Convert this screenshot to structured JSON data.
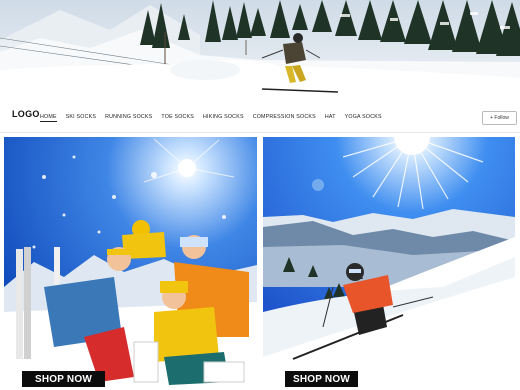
{
  "brand": {
    "logo_text": "LOGO"
  },
  "nav": {
    "items": [
      {
        "label": "HOME"
      },
      {
        "label": "SKI SOCKS"
      },
      {
        "label": "RUNNING SOCKS"
      },
      {
        "label": "TOE SOCKS"
      },
      {
        "label": "HIKING SOCKS"
      },
      {
        "label": "COMPRESSION SOCKS"
      },
      {
        "label": "HAT"
      },
      {
        "label": "YOGA SOCKS"
      }
    ],
    "active_index": 0,
    "follow_label": "+ Follow"
  },
  "promos": [
    {
      "cta_label": "SHOP NOW"
    },
    {
      "cta_label": "SHOP NOW"
    }
  ],
  "colors": {
    "cta_bg": "#0c0c0c",
    "cta_text": "#ffffff",
    "sky_blue": "#1b5fc8"
  }
}
